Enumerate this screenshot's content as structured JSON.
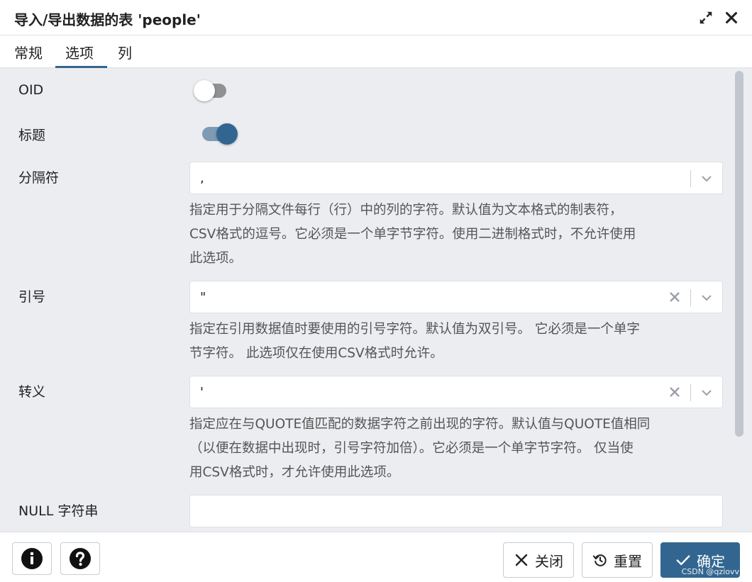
{
  "dialog": {
    "title": "导入/导出数据的表 'people'",
    "icons": {
      "maximize": "maximize-icon",
      "close": "close-icon"
    }
  },
  "tabs": [
    {
      "label": "常规",
      "active": false
    },
    {
      "label": "选项",
      "active": true
    },
    {
      "label": "列",
      "active": false
    }
  ],
  "fields": {
    "oid": {
      "label": "OID",
      "toggle": "off"
    },
    "header": {
      "label": "标题",
      "toggle": "on"
    },
    "delimiter": {
      "label": "分隔符",
      "value": ",",
      "help_lines": [
        "指定用于分隔文件每行（行）中的列的字符。默认值为文本格式的制表符，",
        "CSV格式的逗号。它必须是一个单字节字符。使用二进制格式时，不允许使用",
        "此选项。"
      ]
    },
    "quote": {
      "label": "引号",
      "value": "\"",
      "help_lines": [
        "指定在引用数据值时要使用的引号字符。默认值为双引号。 它必须是一个单字",
        "节字符。 此选项仅在使用CSV格式时允许。"
      ]
    },
    "escape": {
      "label": "转义",
      "value": "'",
      "help_lines": [
        "指定应在与QUOTE值匹配的数据字符之前出现的字符。默认值与QUOTE值相同",
        "（以便在数据中出现时，引号字符加倍）。它必须是一个单字节字符。 仅当使",
        "用CSV格式时，才允许使用此选项。"
      ]
    },
    "null_string": {
      "label": "NULL 字符串",
      "value": ""
    }
  },
  "footer": {
    "info_icon": "info-icon",
    "help_icon": "help-icon",
    "close_label": "关闭",
    "reset_label": "重置",
    "ok_label": "确定",
    "watermark": "CSDN @qziovv"
  },
  "colors": {
    "accent": "#326690",
    "background": "#ebedf0"
  }
}
